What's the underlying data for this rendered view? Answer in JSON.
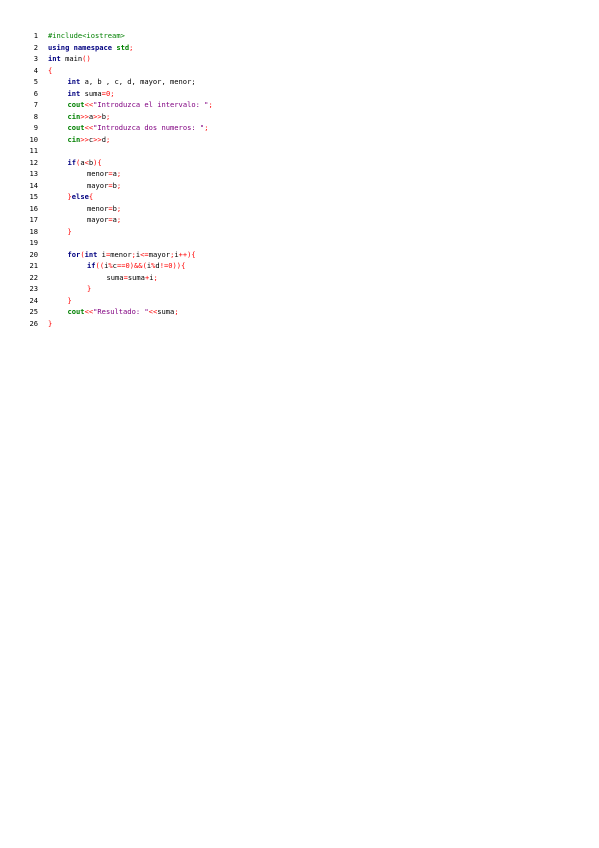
{
  "document": {
    "colors": {
      "keyword": "#000080",
      "string": "#800080",
      "number": "#ff0000",
      "operator": "#ff0000",
      "identifier": "#000000",
      "preprocessor": "#008000",
      "line_number": "#000000",
      "background": "#ffffff"
    },
    "lines": [
      {
        "number": "1",
        "indent": 0,
        "tokens": [
          {
            "t": "pp",
            "v": "#include<iostream>"
          }
        ]
      },
      {
        "number": "2",
        "indent": 0,
        "tokens": [
          {
            "t": "kw",
            "v": "using"
          },
          {
            "t": "id",
            "v": " "
          },
          {
            "t": "kw",
            "v": "namespace"
          },
          {
            "t": "id",
            "v": " "
          },
          {
            "t": "green",
            "v": "std"
          },
          {
            "t": "op",
            "v": ";"
          }
        ]
      },
      {
        "number": "3",
        "indent": 0,
        "tokens": [
          {
            "t": "kw",
            "v": "int"
          },
          {
            "t": "id",
            "v": " main"
          },
          {
            "t": "op",
            "v": "()"
          }
        ]
      },
      {
        "number": "4",
        "indent": 0,
        "tokens": [
          {
            "t": "op",
            "v": "{"
          }
        ]
      },
      {
        "number": "5",
        "indent": 1,
        "tokens": [
          {
            "t": "kw",
            "v": "int"
          },
          {
            "t": "id",
            "v": " a, b , c, d, mayor, menor;"
          }
        ]
      },
      {
        "number": "6",
        "indent": 1,
        "tokens": [
          {
            "t": "kw",
            "v": "int"
          },
          {
            "t": "id",
            "v": " suma"
          },
          {
            "t": "op",
            "v": "="
          },
          {
            "t": "num",
            "v": "0"
          },
          {
            "t": "op",
            "v": ";"
          }
        ]
      },
      {
        "number": "7",
        "indent": 1,
        "tokens": [
          {
            "t": "green",
            "v": "cout"
          },
          {
            "t": "op",
            "v": "<<"
          },
          {
            "t": "str",
            "v": "\"Introduzca el intervalo: \""
          },
          {
            "t": "op",
            "v": ";"
          }
        ]
      },
      {
        "number": "8",
        "indent": 1,
        "tokens": [
          {
            "t": "green",
            "v": "cin"
          },
          {
            "t": "op",
            "v": ">>"
          },
          {
            "t": "id",
            "v": "a"
          },
          {
            "t": "op",
            "v": ">>"
          },
          {
            "t": "id",
            "v": "b"
          },
          {
            "t": "op",
            "v": ";"
          }
        ]
      },
      {
        "number": "9",
        "indent": 1,
        "tokens": [
          {
            "t": "green",
            "v": "cout"
          },
          {
            "t": "op",
            "v": "<<"
          },
          {
            "t": "str",
            "v": "\"Introduzca dos numeros: \""
          },
          {
            "t": "op",
            "v": ";"
          }
        ]
      },
      {
        "number": "10",
        "indent": 1,
        "tokens": [
          {
            "t": "green",
            "v": "cin"
          },
          {
            "t": "op",
            "v": ">>"
          },
          {
            "t": "id",
            "v": "c"
          },
          {
            "t": "op",
            "v": ">>"
          },
          {
            "t": "id",
            "v": "d"
          },
          {
            "t": "op",
            "v": ";"
          }
        ]
      },
      {
        "number": "11",
        "indent": 0,
        "tokens": []
      },
      {
        "number": "12",
        "indent": 1,
        "tokens": [
          {
            "t": "kw",
            "v": "if"
          },
          {
            "t": "op",
            "v": "("
          },
          {
            "t": "id",
            "v": "a"
          },
          {
            "t": "op",
            "v": "<"
          },
          {
            "t": "id",
            "v": "b"
          },
          {
            "t": "op",
            "v": "){"
          }
        ]
      },
      {
        "number": "13",
        "indent": 2,
        "tokens": [
          {
            "t": "id",
            "v": "menor"
          },
          {
            "t": "op",
            "v": "="
          },
          {
            "t": "id",
            "v": "a"
          },
          {
            "t": "op",
            "v": ";"
          }
        ]
      },
      {
        "number": "14",
        "indent": 2,
        "tokens": [
          {
            "t": "id",
            "v": "mayor"
          },
          {
            "t": "op",
            "v": "="
          },
          {
            "t": "id",
            "v": "b"
          },
          {
            "t": "op",
            "v": ";"
          }
        ]
      },
      {
        "number": "15",
        "indent": 1,
        "tokens": [
          {
            "t": "op",
            "v": "}"
          },
          {
            "t": "kw",
            "v": "else"
          },
          {
            "t": "op",
            "v": "{"
          }
        ]
      },
      {
        "number": "16",
        "indent": 2,
        "tokens": [
          {
            "t": "id",
            "v": "menor"
          },
          {
            "t": "op",
            "v": "="
          },
          {
            "t": "id",
            "v": "b"
          },
          {
            "t": "op",
            "v": ";"
          }
        ]
      },
      {
        "number": "17",
        "indent": 2,
        "tokens": [
          {
            "t": "id",
            "v": "mayor"
          },
          {
            "t": "op",
            "v": "="
          },
          {
            "t": "id",
            "v": "a"
          },
          {
            "t": "op",
            "v": ";"
          }
        ]
      },
      {
        "number": "18",
        "indent": 1,
        "tokens": [
          {
            "t": "op",
            "v": "}"
          }
        ]
      },
      {
        "number": "19",
        "indent": 0,
        "tokens": []
      },
      {
        "number": "20",
        "indent": 1,
        "tokens": [
          {
            "t": "kw",
            "v": "for"
          },
          {
            "t": "op",
            "v": "("
          },
          {
            "t": "kw",
            "v": "int"
          },
          {
            "t": "id",
            "v": " i"
          },
          {
            "t": "op",
            "v": "="
          },
          {
            "t": "id",
            "v": "menor"
          },
          {
            "t": "op",
            "v": ";"
          },
          {
            "t": "id",
            "v": "i"
          },
          {
            "t": "op",
            "v": "<="
          },
          {
            "t": "id",
            "v": "mayor"
          },
          {
            "t": "op",
            "v": ";"
          },
          {
            "t": "id",
            "v": "i"
          },
          {
            "t": "op",
            "v": "++){"
          }
        ]
      },
      {
        "number": "21",
        "indent": 2,
        "tokens": [
          {
            "t": "kw",
            "v": "if"
          },
          {
            "t": "op",
            "v": "(("
          },
          {
            "t": "id",
            "v": "i"
          },
          {
            "t": "op",
            "v": "%"
          },
          {
            "t": "id",
            "v": "c"
          },
          {
            "t": "op",
            "v": "=="
          },
          {
            "t": "num",
            "v": "0"
          },
          {
            "t": "op",
            "v": ")&&("
          },
          {
            "t": "id",
            "v": "i"
          },
          {
            "t": "op",
            "v": "%"
          },
          {
            "t": "id",
            "v": "d"
          },
          {
            "t": "op",
            "v": "!="
          },
          {
            "t": "num",
            "v": "0"
          },
          {
            "t": "op",
            "v": ")){"
          }
        ]
      },
      {
        "number": "22",
        "indent": 3,
        "tokens": [
          {
            "t": "id",
            "v": "suma"
          },
          {
            "t": "op",
            "v": "="
          },
          {
            "t": "id",
            "v": "suma"
          },
          {
            "t": "op",
            "v": "+"
          },
          {
            "t": "id",
            "v": "i"
          },
          {
            "t": "op",
            "v": ";"
          }
        ]
      },
      {
        "number": "23",
        "indent": 2,
        "tokens": [
          {
            "t": "op",
            "v": "}"
          }
        ]
      },
      {
        "number": "24",
        "indent": 1,
        "tokens": [
          {
            "t": "op",
            "v": "}"
          }
        ]
      },
      {
        "number": "25",
        "indent": 1,
        "tokens": [
          {
            "t": "green",
            "v": "cout"
          },
          {
            "t": "op",
            "v": "<<"
          },
          {
            "t": "str",
            "v": "\"Resultado: \""
          },
          {
            "t": "op",
            "v": "<<"
          },
          {
            "t": "id",
            "v": "suma"
          },
          {
            "t": "op",
            "v": ";"
          }
        ]
      },
      {
        "number": "26",
        "indent": 0,
        "tokens": [
          {
            "t": "op",
            "v": "}"
          }
        ]
      }
    ]
  }
}
